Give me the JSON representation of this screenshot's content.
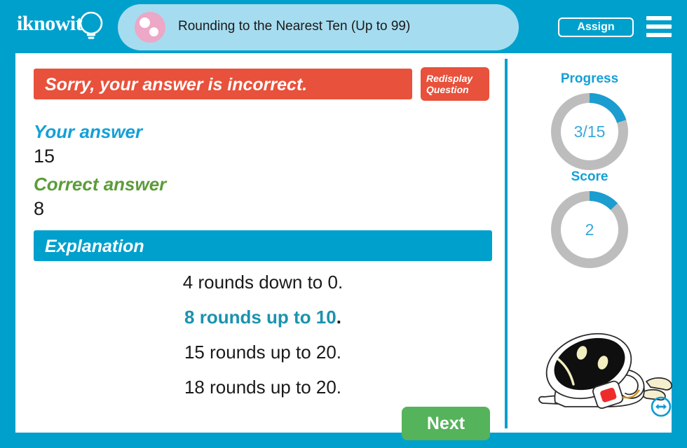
{
  "header": {
    "logo_text": "iknowit",
    "logo_icon": "lightbulb-icon",
    "title": "Rounding to the Nearest Ten (Up to 99)",
    "title_icon": "pink-dots-icon",
    "assign_label": "Assign",
    "menu_icon": "hamburger-menu-icon",
    "bar_color": "#00a0cd",
    "pill_color": "#a6dcef",
    "dot_color": "#eda7c7"
  },
  "question_panel": {
    "result_message": "Sorry, your answer is incorrect.",
    "result_color": "#e8513b",
    "redisplay_line1": "Redisplay",
    "redisplay_line2": "Question",
    "your_answer_label": "Your answer",
    "your_answer_value": "15",
    "your_answer_color": "#14a0d7",
    "correct_answer_label": "Correct answer",
    "correct_answer_value": "8",
    "correct_answer_color": "#5c9c3a",
    "explanation_label": "Explanation",
    "explanation_color": "#00a0cd",
    "explanation_lines": [
      {
        "text": "4 rounds down to 0.",
        "highlighted": false
      },
      {
        "text": "8 rounds up to 10",
        "period": ".",
        "highlighted": true
      },
      {
        "text": "15 rounds up to 20.",
        "highlighted": false
      },
      {
        "text": "18 rounds up to 20.",
        "highlighted": false
      }
    ],
    "next_label": "Next",
    "next_color": "#55b35b"
  },
  "stats_panel": {
    "progress_label": "Progress",
    "progress_value": "3/15",
    "progress_current": 3,
    "progress_total": 15,
    "progress_percent": 20,
    "score_label": "Score",
    "score_value": "2",
    "score_percent": 13,
    "arc_color": "#1b9dd0",
    "track_color": "#bdbdbd",
    "mascot_icon": "sad-robot-mascot",
    "resize_icon": "double-arrow-resize-icon"
  }
}
